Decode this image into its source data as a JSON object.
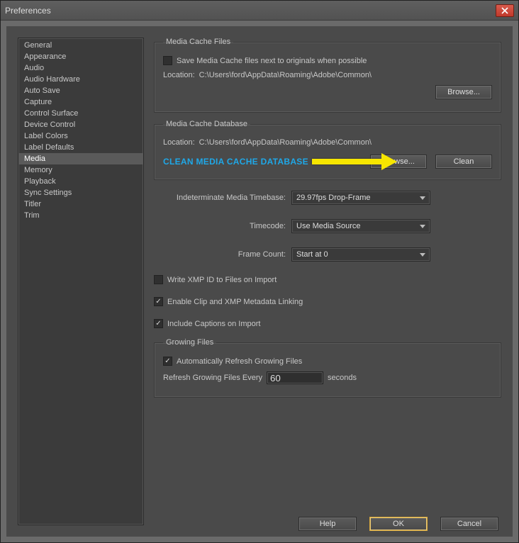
{
  "window": {
    "title": "Preferences"
  },
  "sidebar": {
    "items": [
      "General",
      "Appearance",
      "Audio",
      "Audio Hardware",
      "Auto Save",
      "Capture",
      "Control Surface",
      "Device Control",
      "Label Colors",
      "Label Defaults",
      "Media",
      "Memory",
      "Playback",
      "Sync Settings",
      "Titler",
      "Trim"
    ],
    "selected_index": 10
  },
  "cache_files": {
    "legend": "Media Cache Files",
    "checkbox_label": "Save Media Cache files next to originals when possible",
    "checkbox_checked": false,
    "location_label": "Location:",
    "location_path": "C:\\Users\\ford\\AppData\\Roaming\\Adobe\\Common\\",
    "browse_label": "Browse..."
  },
  "cache_db": {
    "legend": "Media Cache Database",
    "location_label": "Location:",
    "location_path": "C:\\Users\\ford\\AppData\\Roaming\\Adobe\\Common\\",
    "clean_callout": "CLEAN MEDIA CACHE DATABASE",
    "browse_label": "Browse...",
    "clean_label": "Clean"
  },
  "dropdowns": {
    "timebase_label": "Indeterminate Media Timebase:",
    "timebase_value": "29.97fps Drop-Frame",
    "timecode_label": "Timecode:",
    "timecode_value": "Use Media Source",
    "framecount_label": "Frame Count:",
    "framecount_value": "Start at 0"
  },
  "checks": {
    "xmp_id_label": "Write XMP ID to Files on Import",
    "xmp_id_checked": false,
    "clip_link_label": "Enable Clip and XMP Metadata Linking",
    "clip_link_checked": true,
    "captions_label": "Include Captions on Import",
    "captions_checked": true
  },
  "growing": {
    "legend": "Growing Files",
    "auto_refresh_label": "Automatically Refresh Growing Files",
    "auto_refresh_checked": true,
    "refresh_every_prefix": "Refresh Growing Files Every",
    "refresh_every_value": "60",
    "refresh_every_suffix": "seconds"
  },
  "footer": {
    "help": "Help",
    "ok": "OK",
    "cancel": "Cancel"
  }
}
